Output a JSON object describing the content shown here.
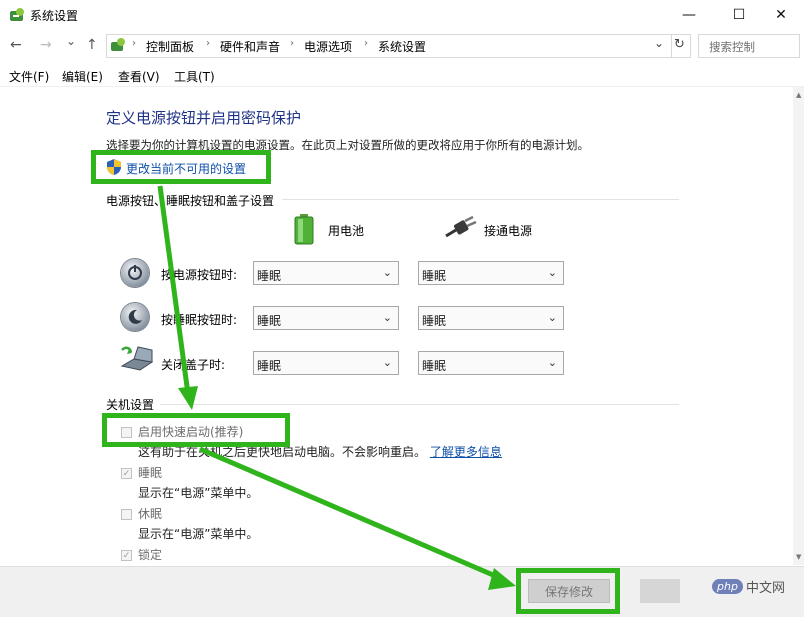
{
  "window": {
    "title": "系统设置",
    "minimize": "—",
    "maximize": "☐",
    "close": "✕"
  },
  "nav": {
    "back": "←",
    "forward": "→",
    "dropdown": "⌄",
    "up": "↑",
    "refresh": "↻"
  },
  "breadcrumb": [
    "控制面板",
    "硬件和声音",
    "电源选项",
    "系统设置"
  ],
  "search": {
    "placeholder": "搜索控制"
  },
  "menu": [
    "文件(F)",
    "编辑(E)",
    "查看(V)",
    "工具(T)"
  ],
  "content": {
    "heading": "定义电源按钮并启用密码保护",
    "subtitle": "选择要为你的计算机设置的电源设置。在此页上对设置所做的更改将应用于你所有的电源计划。",
    "change_link": "更改当前不可用的设置",
    "power_section": {
      "title": "电源按钮、睡眠按钮和盖子设置",
      "columns": [
        "用电池",
        "接通电源"
      ],
      "rows": [
        {
          "label": "按电源按钮时:",
          "battery": "睡眠",
          "plugged": "睡眠"
        },
        {
          "label": "按睡眠按钮时:",
          "battery": "睡眠",
          "plugged": "睡眠"
        },
        {
          "label": "关闭盖子时:",
          "battery": "睡眠",
          "plugged": "睡眠"
        }
      ]
    },
    "shutdown_section": {
      "title": "关机设置",
      "items": [
        {
          "label": "启用快速启动(推荐)",
          "checked": false,
          "desc": "这有助于在关机之后更快地启动电脑。不会影响重启。",
          "link": "了解更多信息"
        },
        {
          "label": "睡眠",
          "checked": true,
          "desc": "显示在“电源”菜单中。"
        },
        {
          "label": "休眠",
          "checked": false,
          "desc": "显示在“电源”菜单中。"
        },
        {
          "label": "锁定",
          "checked": true
        }
      ]
    }
  },
  "buttons": {
    "save": "保存修改"
  },
  "watermark": {
    "badge": "php",
    "text": "中文网"
  },
  "annotation_color": "#2fb41c"
}
